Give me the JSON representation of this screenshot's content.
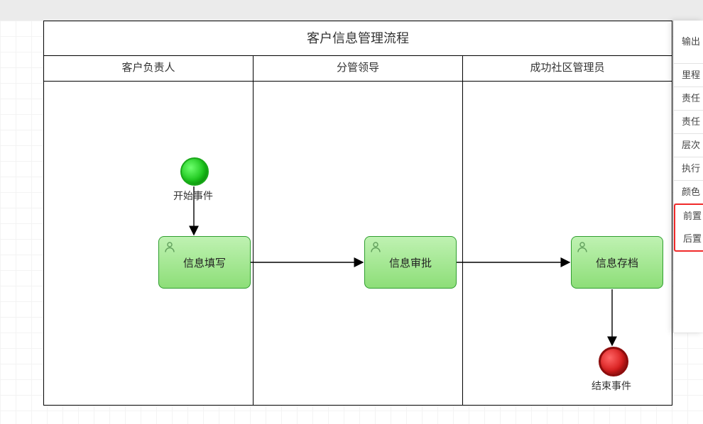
{
  "pool": {
    "title": "客户信息管理流程",
    "lanes": [
      "客户负责人",
      "分管领导",
      "成功社区管理员"
    ]
  },
  "nodes": {
    "start": {
      "label": "开始事件"
    },
    "task1": {
      "label": "信息填写"
    },
    "task2": {
      "label": "信息审批"
    },
    "task3": {
      "label": "信息存档"
    },
    "end": {
      "label": "结束事件"
    }
  },
  "panel": {
    "items": [
      "输出",
      "里程",
      "责任",
      "责任",
      "层次",
      "执行",
      "颜色",
      "前置",
      "后置"
    ]
  }
}
